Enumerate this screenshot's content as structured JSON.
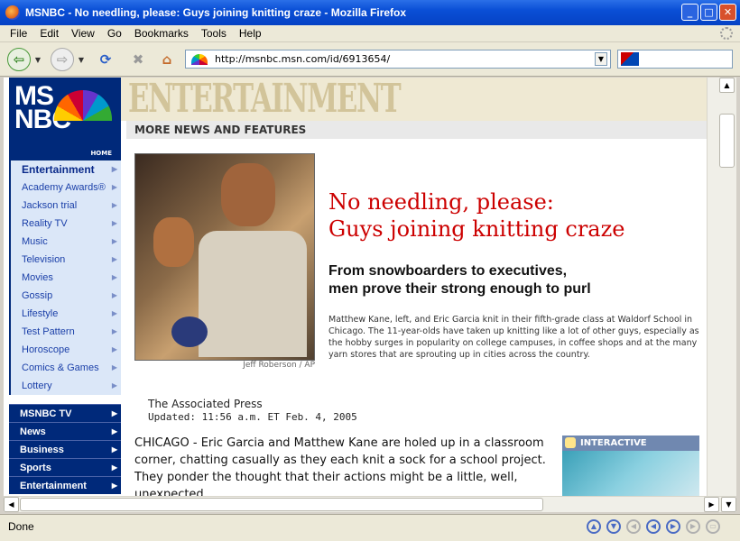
{
  "window": {
    "title": "MSNBC - No needling, please: Guys joining knitting craze - Mozilla Firefox"
  },
  "menu": [
    "File",
    "Edit",
    "View",
    "Go",
    "Bookmarks",
    "Tools",
    "Help"
  ],
  "address": {
    "url": "http://msnbc.msn.com/id/6913654/"
  },
  "status": {
    "text": "Done"
  },
  "site": {
    "logo_text": "MSNBC",
    "logo_home": "HOME",
    "section_banner": "ENTERTAINMENT",
    "section_strip": "MORE NEWS AND FEATURES"
  },
  "nav_primary": [
    {
      "label": "Entertainment"
    },
    {
      "label": "Academy Awards®"
    },
    {
      "label": "Jackson trial"
    },
    {
      "label": "Reality TV"
    },
    {
      "label": "Music"
    },
    {
      "label": "Television"
    },
    {
      "label": "Movies"
    },
    {
      "label": "Gossip"
    },
    {
      "label": "Lifestyle"
    },
    {
      "label": "Test Pattern"
    },
    {
      "label": "Horoscope"
    },
    {
      "label": "Comics & Games"
    },
    {
      "label": "Lottery"
    }
  ],
  "nav_secondary": [
    {
      "label": "MSNBC TV"
    },
    {
      "label": "News"
    },
    {
      "label": "Business"
    },
    {
      "label": "Sports"
    },
    {
      "label": "Entertainment"
    }
  ],
  "article": {
    "headline_line1": "No needling, please:",
    "headline_line2": "Guys joining knitting craze",
    "subhead_line1": "From snowboarders to executives,",
    "subhead_line2": "men prove their strong enough to purl",
    "photo_credit": "Jeff Roberson / AP",
    "caption": "Matthew Kane, left, and Eric Garcia knit in their fifth-grade class at Waldorf School in Chicago. The 11-year-olds have taken up knitting like a lot of other guys, especially as the hobby surges in popularity on college campuses, in coffee shops and at the many yarn stores that are sprouting up in cities across the country.",
    "source": "The Associated Press",
    "updated": "Updated: 11:56 a.m. ET Feb. 4, 2005",
    "body": "CHICAGO - Eric Garcia and Matthew Kane are holed up in a classroom corner, chatting casually as they each knit a sock for a school project. They ponder the thought that their actions might be a little, well, unexpected."
  },
  "interactive": {
    "label": "INTERACTIVE"
  }
}
